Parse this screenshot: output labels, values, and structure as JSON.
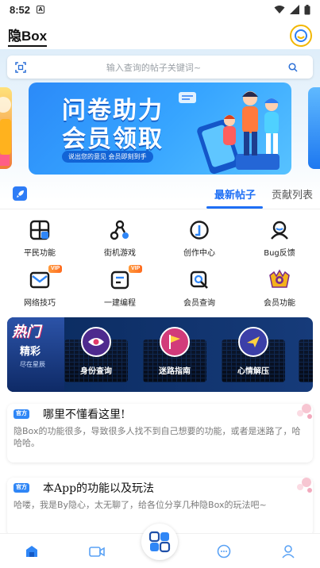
{
  "status": {
    "time": "8:52",
    "sim": "A"
  },
  "header": {
    "title": "隐Box"
  },
  "search": {
    "placeholder": "输入查询的帖子关键词~"
  },
  "banner": {
    "line1": "问卷助力",
    "line2": "会员领取",
    "subtitle": "说出您的意见 会员即刻到手"
  },
  "tabs": [
    {
      "label": "最新帖子",
      "active": true
    },
    {
      "label": "贡献列表",
      "active": false
    }
  ],
  "grid": [
    {
      "label": "平民功能",
      "icon": "frame-icon",
      "vip": false
    },
    {
      "label": "街机游戏",
      "icon": "game-nodes-icon",
      "vip": false
    },
    {
      "label": "创作中心",
      "icon": "create-icon",
      "vip": false
    },
    {
      "label": "Bug反馈",
      "icon": "bug-feedback-icon",
      "vip": false
    },
    {
      "label": "网络技巧",
      "icon": "mail-icon",
      "vip": true,
      "vip_label": "VIP"
    },
    {
      "label": "一建编程",
      "icon": "code-doc-icon",
      "vip": true,
      "vip_label": "VIP"
    },
    {
      "label": "会员查询",
      "icon": "member-search-icon",
      "vip": false
    },
    {
      "label": "会员功能",
      "icon": "member-crown-icon",
      "vip": false
    }
  ],
  "hot": {
    "badge": "热门",
    "title": "精彩",
    "subtitle": "尽在星辰",
    "cards": [
      {
        "label": "身份查询",
        "icon": "eye-icon"
      },
      {
        "label": "迷路指南",
        "icon": "flag-icon"
      },
      {
        "label": "心情解压",
        "icon": "plane-icon"
      }
    ]
  },
  "posts": [
    {
      "badge": "官方",
      "title": "哪里不懂看这里!",
      "body": "隐Box的功能很多，导致很多人找不到自己想要的功能，或者是迷路了，哈哈哈。"
    },
    {
      "badge": "官方",
      "title": "本App的功能以及玩法",
      "body": "哈喽，我是By隐心，太无聊了，给各位分享几种隐Box的玩法吧~"
    }
  ],
  "nav": [
    "home-icon",
    "video-icon",
    "apps-icon",
    "chat-icon",
    "profile-icon"
  ],
  "colors": {
    "accent": "#1e6ff5",
    "hot_bg": "#0a2a5e",
    "vip": "#ff7a2a"
  }
}
